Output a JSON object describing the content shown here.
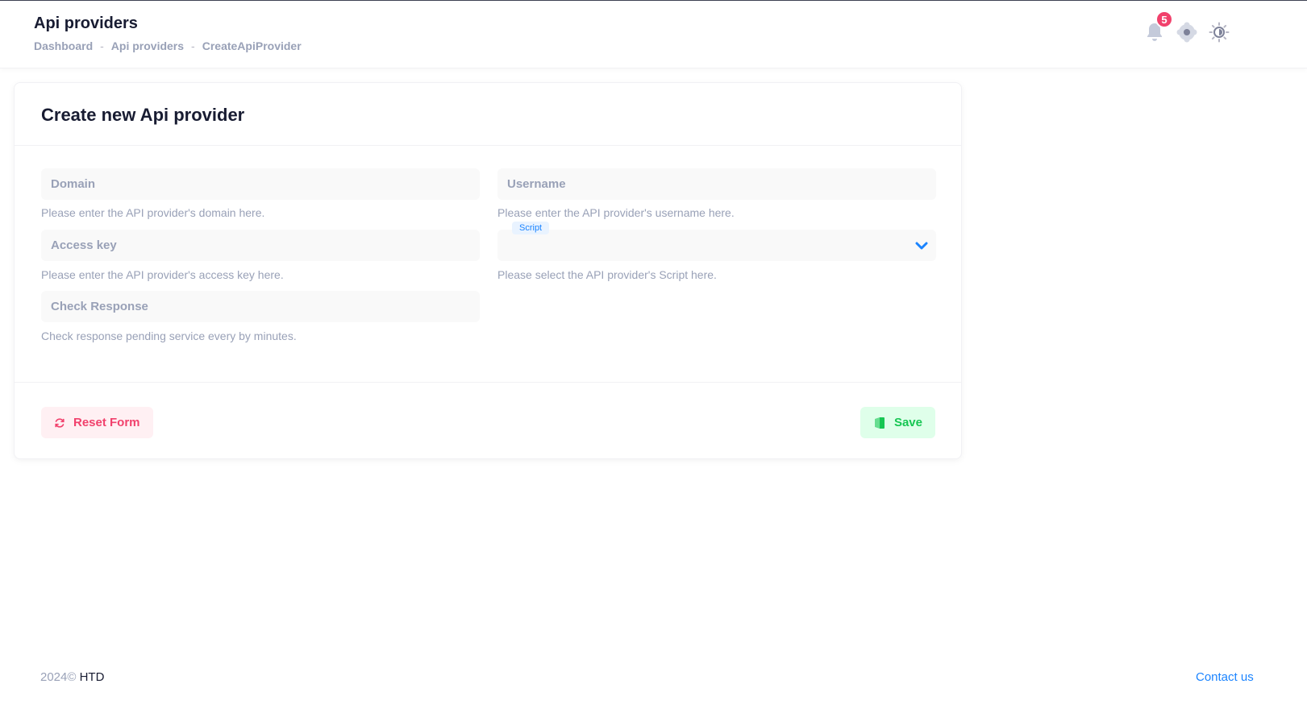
{
  "header": {
    "title": "Api providers",
    "breadcrumb": [
      {
        "label": "Dashboard"
      },
      {
        "label": "Api providers"
      },
      {
        "label": "CreateApiProvider"
      }
    ],
    "breadcrumb_separator": "-",
    "notification_count": "5",
    "icons": [
      "bell-icon",
      "settings-icon",
      "theme-sun-icon"
    ]
  },
  "form": {
    "title": "Create new Api provider",
    "domain": {
      "placeholder": "Domain",
      "value": "",
      "hint": "Please enter the API provider's domain here."
    },
    "username": {
      "placeholder": "Username",
      "value": "",
      "hint": "Please enter the API provider's username here."
    },
    "access_key": {
      "placeholder": "Access key",
      "value": "",
      "hint": "Please enter the API provider's access key here."
    },
    "script": {
      "label": "Script",
      "value": "",
      "hint": "Please select the API provider's Script here."
    },
    "check_response": {
      "placeholder": "Check Response",
      "value": "",
      "hint": "Check response pending service every by minutes."
    }
  },
  "actions": {
    "reset_label": "Reset Form",
    "save_label": "Save"
  },
  "footer": {
    "year": "2024©",
    "brand": "HTD",
    "contact": "Contact us"
  },
  "colors": {
    "accent": "#1b84ff",
    "danger": "#f1416c",
    "success": "#17c653",
    "muted": "#99a1b7"
  }
}
